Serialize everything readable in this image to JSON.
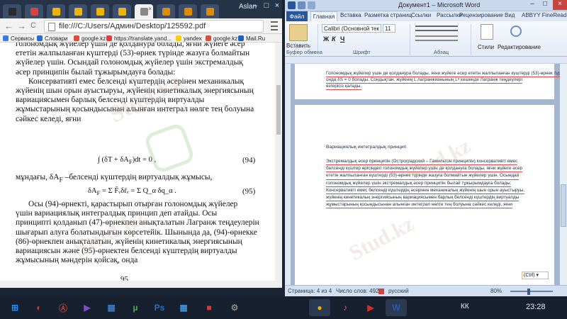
{
  "chrome": {
    "profile": "Aslan",
    "url": "file:///C:/Users/Админ/Desktop/125592.pdf",
    "tab_close": "×",
    "win_min": "–",
    "win_max": "□",
    "win_close": "×",
    "nav_back": "←",
    "nav_fwd": "→",
    "nav_reload": "C",
    "bookmarks": [
      {
        "label": "Сервисы",
        "color": "#3b7be0"
      },
      {
        "label": "Словари",
        "color": "#2a6ad4"
      },
      {
        "label": "google.kz",
        "color": "#dd4b39"
      },
      {
        "label": "https://translate.yand...",
        "color": "#e03c3c"
      },
      {
        "label": "yandex",
        "color": "#ffcc00"
      },
      {
        "label": "google.kz",
        "color": "#dd4b39"
      },
      {
        "label": "Mail.Ru",
        "color": "#1f5fbf"
      }
    ],
    "tab_colors": [
      "#2b2b2b",
      "#d9433a",
      "#f0b400",
      "#f0b400",
      "#f0b400",
      "#f0b400",
      "#888888",
      "#e08a00",
      "#e08a00",
      "#e08a00"
    ]
  },
  "pdf": {
    "lines": [
      "голономдық жүйелер үшін де қолданура болады, яғни жүйеге әсер",
      "ететін жалпыланған күштерді (53)-өрнек түрінде жазуға болмайтын",
      "жүйелер үшін. Осындай голономдық жүйелер үшін экстремалдық",
      "әсер принципін былай тұжырымдауға болады:",
      "Консервативті емес белсенді күштердің әсерінен механикалық",
      "жүйенің шын орын ауыстыруы, жүйенің кинетикалық энергиясының",
      "вариациясымен барлық белсенді күштердің виртуалды",
      "жұмыстарының қосындысынан алынған интеграл нөлге тең болуына",
      "сәйкес келеді, яғни"
    ],
    "eq94": "∫ (δT + δA",
    "eq94_sub": "F",
    "eq94_tail": ")dt = 0 ,",
    "eq94_num": "(94)",
    "between": "мұндағы, δA",
    "between_sub": "F",
    "between_tail": "–белсенді күштердің виртуалдық жұмысы,",
    "eq95": "δA",
    "eq95_sub": "F",
    "eq95_tail": "= Σ F̄ᵥδr̄ᵥ = Σ Q_α δq_α .",
    "eq95_num": "(95)",
    "lines2": [
      "Осы (94)-өрнекті, қарастырып отырған голономдық жүйелер",
      "үшін вариациялық интегралдық принцип деп атайды. Осы",
      "принципті қолданып (47)-өрнекпен анықталатын Лагранж теңдеулерін",
      "шығарып алуға болатындығын көрсетейік. Шынында да, (94)-өрнекке",
      "(86)-өрнекпен анықталатын, жүйенің кинетикалық энергиясының",
      "вариациясын және (95)-өрнектен белсенді күштердің виртуалды",
      "жұмысының мәндерін қойсақ, онда"
    ],
    "page_number": "95"
  },
  "word": {
    "title": "Документ1 – Microsoft Word",
    "min": "–",
    "max": "□",
    "close": "×",
    "tabs": {
      "file": "Файл",
      "home": "Главная",
      "others": [
        "Вставка",
        "Разметка страниц",
        "Ссылки",
        "Рассылки",
        "Рецензирование",
        "Вид",
        "ABBYY FineReader"
      ]
    },
    "ribbon": {
      "paste": "Вставить",
      "font_name": "Calibri (Основной тек",
      "font_size": "11",
      "styles": "Стили",
      "editing": "Редактирование",
      "groups": [
        "Буфер обмена",
        "Шрифт",
        "Абзац"
      ],
      "fmt": [
        "Ж",
        "К",
        "Ч"
      ]
    },
    "page1_lines": [
      "Голономдық жүйелер үшін де қолданура болады, яғни жүйеге әсер ететін жалпыланған күштерді (53)-өрнек түрінде",
      "онда δS = 0 болады. Сондықтан, жүйенің L лагранжианының Lᵃ кешенде Лагранж теңдеулері",
      "өзгерісіз қалады."
    ],
    "page2_heading": "Вариациялық интегралдық принцип",
    "page2_lines": [
      "Экстремалдық әсер принципін (Остроградский – Гамильтон принципін) консервативті емес",
      "белсенді күштер өрісіндегі голономдық жүйелер үшін де қолдануға болады, яғни жүйеге әсер",
      "ететін жалпыланған күштерді (53)-өрнек түрінде жазуға болмайтын жүйелер үшін. Осындай",
      "голономдық жүйелер үшін экстремалдық әсер принципін былай тұжырымдауға болады:",
      "Консервативті емес белсенді күштердің әсерінен механикалық жүйенің шын орын ауыстыруы,",
      "жүйенің кинетикалық энергиясының вариациясымен барлық белсенді күштердің виртуалды",
      "жұмыстарының қосындысынан алынған интеграл нөлге тең болуына сәйкес келеді, яғни"
    ],
    "ctrl_badge": "(Ctrl) ▾",
    "status": {
      "page": "Страница: 4 из 4",
      "words": "Число слов: 492",
      "lang": "русский",
      "zoom": "80%"
    }
  },
  "taskbar": {
    "items": [
      {
        "glyph": "⊞",
        "color": "#1e90ff"
      },
      {
        "glyph": "◐",
        "color": "#d43c2c"
      },
      {
        "glyph": "Ⓐ",
        "color": "#c0392b"
      },
      {
        "glyph": "▶",
        "color": "#7c4dbd"
      },
      {
        "glyph": "▦",
        "color": "#3a78c2"
      },
      {
        "glyph": "µ",
        "color": "#4caf50"
      },
      {
        "glyph": "Ps",
        "color": "#2b6fb5"
      },
      {
        "glyph": "▦",
        "color": "#3c8fd8"
      },
      {
        "glyph": "■",
        "color": "#d83b3b"
      },
      {
        "glyph": "⚙",
        "color": "#888888"
      },
      {
        "glyph": "●",
        "color": "#e8b100"
      },
      {
        "glyph": "♪",
        "color": "#e05a8a"
      },
      {
        "glyph": "▶",
        "color": "#d12c2c"
      },
      {
        "glyph": "W",
        "color": "#2a5ab3"
      }
    ],
    "tray": "КК",
    "time": "23:28"
  },
  "watermark": "Stud.kz"
}
